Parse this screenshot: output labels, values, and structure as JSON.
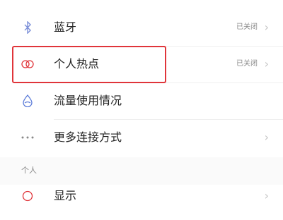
{
  "settings": {
    "items": [
      {
        "icon": "bluetooth-icon",
        "label": "蓝牙",
        "status": "已关闭"
      },
      {
        "icon": "hotspot-icon",
        "label": "个人热点",
        "status": "已关闭"
      },
      {
        "icon": "data-usage-icon",
        "label": "流量使用情况",
        "status": ""
      },
      {
        "icon": "more-icon",
        "label": "更多连接方式",
        "status": ""
      }
    ],
    "section_personal": "个人",
    "display_item": {
      "icon": "display-icon",
      "label": "显示"
    }
  },
  "colors": {
    "highlight": "#e0353a",
    "hotspot_icon": "#e0353a",
    "accent_icon": "#5a7ad8"
  }
}
